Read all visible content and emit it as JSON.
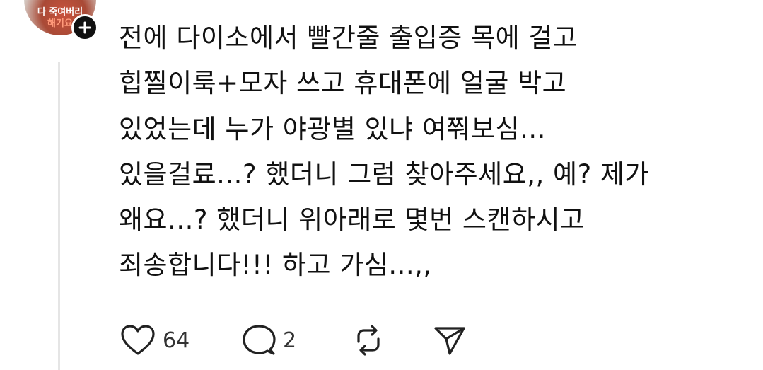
{
  "author": {
    "avatar_text": [
      "다 죽여버리",
      "해기요"
    ]
  },
  "post": {
    "lines": [
      "전에 다이소에서 빨간줄 출입증 목에 걸고",
      "힙찔이룩+모자 쓰고 휴대폰에 얼굴 박고",
      "있었는데 누가 야광별 있냐 여쭤보심...",
      "있을걸료...? 했더니 그럼 찾아주세요,, 예? 제가",
      "왜요...? 했더니 위아래로 몇번 스캔하시고",
      "죄송합니다!!! 하고 가심...,,"
    ]
  },
  "actions": {
    "like_count": "64",
    "reply_count": "2",
    "icons": [
      "heart-icon",
      "comment-icon",
      "repost-icon",
      "share-icon"
    ]
  },
  "colors": {
    "text": "#111111",
    "thread_line": "#e5e5e5",
    "follow_button": "#111111"
  }
}
